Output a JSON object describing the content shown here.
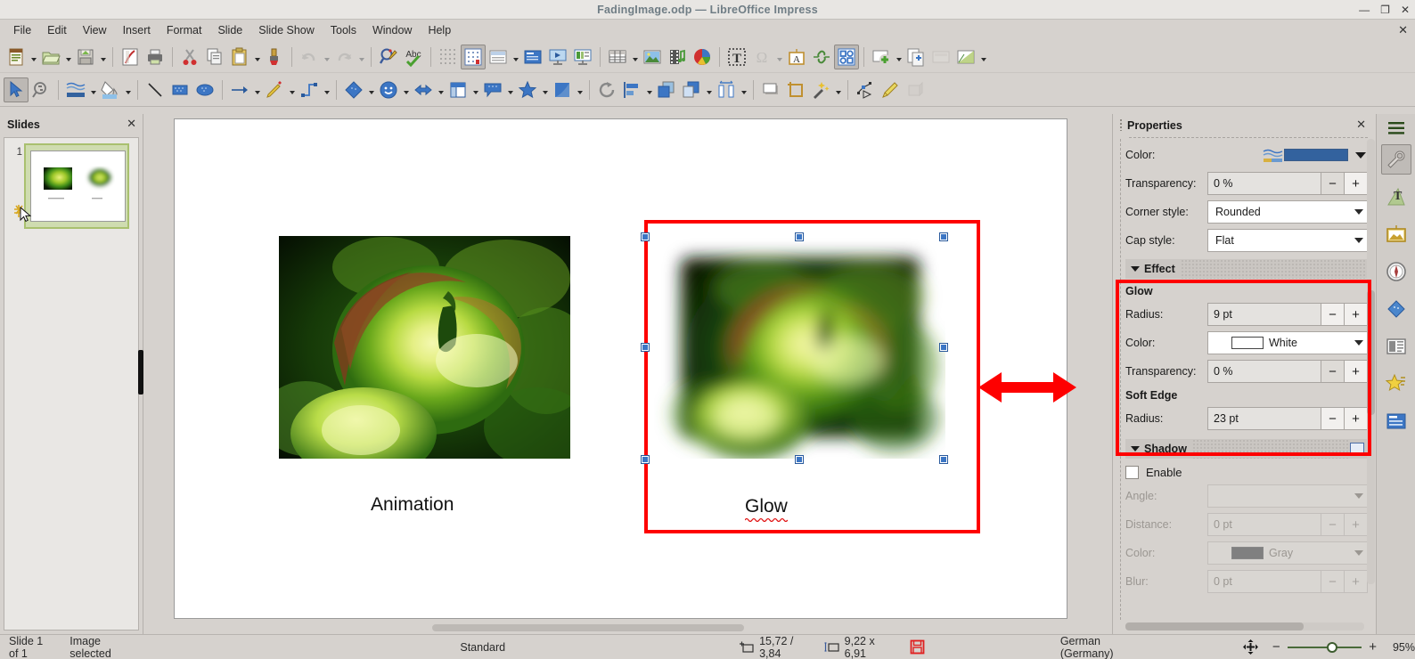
{
  "window": {
    "title": "FadingImage.odp — LibreOffice Impress",
    "minimize": "—",
    "maximize": "❐",
    "close": "✕"
  },
  "menubar": {
    "items": [
      "File",
      "Edit",
      "View",
      "Insert",
      "Format",
      "Slide",
      "Slide Show",
      "Tools",
      "Window",
      "Help"
    ],
    "close_doc": "✕"
  },
  "toolbar_main": {
    "items": [
      {
        "name": "new-document",
        "dropdown": true
      },
      {
        "name": "open-document",
        "dropdown": true
      },
      {
        "name": "save-document",
        "dropdown": true
      },
      {
        "name": "export-pdf",
        "dropdown": false
      },
      {
        "name": "print",
        "dropdown": false
      },
      {
        "name": "cut",
        "dropdown": false
      },
      {
        "name": "copy",
        "dropdown": false
      },
      {
        "name": "paste",
        "dropdown": true
      },
      {
        "name": "clone-formatting",
        "dropdown": false
      },
      {
        "name": "undo",
        "dropdown": true,
        "disabled": true
      },
      {
        "name": "redo",
        "dropdown": true,
        "disabled": true
      },
      {
        "name": "find-replace",
        "dropdown": false
      },
      {
        "name": "spelling",
        "dropdown": false
      },
      {
        "name": "display-grid",
        "dropdown": false
      },
      {
        "name": "snap-to-grid",
        "dropdown": false,
        "active": true
      },
      {
        "name": "master-slide",
        "dropdown": true
      },
      {
        "name": "display-views",
        "dropdown": false
      },
      {
        "name": "start-from-first-slide",
        "dropdown": false
      },
      {
        "name": "start-from-current-slide",
        "dropdown": false
      },
      {
        "name": "insert-table",
        "dropdown": true
      },
      {
        "name": "insert-image",
        "dropdown": false
      },
      {
        "name": "insert-audio-video",
        "dropdown": false
      },
      {
        "name": "insert-chart",
        "dropdown": false
      },
      {
        "name": "insert-text-box",
        "dropdown": false
      },
      {
        "name": "insert-special-character",
        "dropdown": true,
        "disabled": true
      },
      {
        "name": "insert-fontwork",
        "dropdown": false
      },
      {
        "name": "insert-hyperlink",
        "dropdown": false
      },
      {
        "name": "show-draw-functions",
        "dropdown": false,
        "active": true
      },
      {
        "name": "new-slide",
        "dropdown": true
      },
      {
        "name": "duplicate-slide",
        "dropdown": false
      },
      {
        "name": "slide-layout",
        "dropdown": false,
        "disabled": true
      },
      {
        "name": "master-slide-design",
        "dropdown": true
      }
    ]
  },
  "toolbar_draw": {
    "items": [
      {
        "name": "select-tool",
        "active": true
      },
      {
        "name": "zoom-tool"
      },
      {
        "name": "line-color",
        "dropdown": true
      },
      {
        "name": "fill-color",
        "dropdown": true
      },
      {
        "name": "insert-line"
      },
      {
        "name": "rectangle"
      },
      {
        "name": "ellipse"
      },
      {
        "name": "lines-and-arrows",
        "dropdown": true
      },
      {
        "name": "curves-and-polygons",
        "dropdown": true
      },
      {
        "name": "connectors",
        "dropdown": true
      },
      {
        "name": "basic-shapes",
        "dropdown": true
      },
      {
        "name": "symbol-shapes",
        "dropdown": true
      },
      {
        "name": "block-arrows",
        "dropdown": true
      },
      {
        "name": "flowchart-shapes",
        "dropdown": true
      },
      {
        "name": "callout-shapes",
        "dropdown": true
      },
      {
        "name": "stars-and-banners",
        "dropdown": true
      },
      {
        "name": "3d-objects",
        "dropdown": true
      },
      {
        "name": "rotate"
      },
      {
        "name": "align-objects",
        "dropdown": true
      },
      {
        "name": "arrange",
        "dropdown": true
      },
      {
        "name": "distribute-selection",
        "dropdown": true
      },
      {
        "name": "shadow"
      },
      {
        "name": "crop-image"
      },
      {
        "name": "filter",
        "dropdown": true
      },
      {
        "name": "points"
      },
      {
        "name": "glue-points"
      },
      {
        "name": "toggle-extrusion",
        "disabled": true
      }
    ]
  },
  "slides_panel": {
    "title": "Slides",
    "close": "✕",
    "slides": [
      {
        "number": "1"
      }
    ]
  },
  "canvas": {
    "captions": [
      {
        "name": "animation",
        "text": "Animation",
        "misspelled": false
      },
      {
        "name": "glow",
        "text": "Glow",
        "misspelled": true
      }
    ]
  },
  "properties": {
    "title": "Properties",
    "close": "✕",
    "line_section": {
      "color_label": "Color:",
      "color_value": "#33629e",
      "transparency_label": "Transparency:",
      "transparency_value": "0 %",
      "corner_style_label": "Corner style:",
      "corner_style_value": "Rounded",
      "cap_style_label": "Cap style:",
      "cap_style_value": "Flat"
    },
    "effect_section": {
      "title": "Effect",
      "glow_label": "Glow",
      "glow_radius_label": "Radius:",
      "glow_radius_value": "9 pt",
      "glow_color_label": "Color:",
      "glow_color_value": "White",
      "glow_color_hex": "#ffffff",
      "glow_transparency_label": "Transparency:",
      "glow_transparency_value": "0 %",
      "soft_edge_label": "Soft Edge",
      "soft_edge_radius_label": "Radius:",
      "soft_edge_radius_value": "23 pt"
    },
    "shadow_section": {
      "title": "Shadow",
      "enable_label": "Enable",
      "enabled": false,
      "angle_label": "Angle:",
      "angle_value": "",
      "distance_label": "Distance:",
      "distance_value": "0 pt",
      "color_label": "Color:",
      "color_value": "Gray",
      "color_hex": "#808080",
      "blur_label": "Blur:",
      "blur_value": "0 pt"
    },
    "spin_minus": "−",
    "spin_plus": "+"
  },
  "sidebar_rail": {
    "menu": "hamburger-icon",
    "tabs": [
      {
        "name": "properties",
        "icon": "wrench-icon",
        "selected": true
      },
      {
        "name": "styles",
        "icon": "text-style-icon",
        "selected": false
      },
      {
        "name": "gallery",
        "icon": "gallery-icon",
        "selected": false
      },
      {
        "name": "navigator",
        "icon": "compass-icon",
        "selected": false
      },
      {
        "name": "shapes",
        "icon": "shapes-icon",
        "selected": false
      },
      {
        "name": "master-slides",
        "icon": "master-slides-icon",
        "selected": false
      },
      {
        "name": "animation",
        "icon": "star-icon",
        "selected": false
      },
      {
        "name": "slide-transition",
        "icon": "transition-icon",
        "selected": false
      }
    ]
  },
  "statusbar": {
    "slide_info": "Slide 1 of 1",
    "selection_info": "Image selected",
    "master": "Standard",
    "position": "15,72 / 3,84",
    "size": "9,22 x 6,91",
    "save_icon": "unsaved-changes-icon",
    "language": "German (Germany)",
    "fit_icon": "fit-slide-icon",
    "zoom_out": "−",
    "zoom_in": "+",
    "zoom_level": "95%"
  },
  "annotations": {
    "red_rect_canvas": "#fe0000",
    "red_arrow": "#fe0000",
    "red_rect_effect": "#fe0000"
  }
}
